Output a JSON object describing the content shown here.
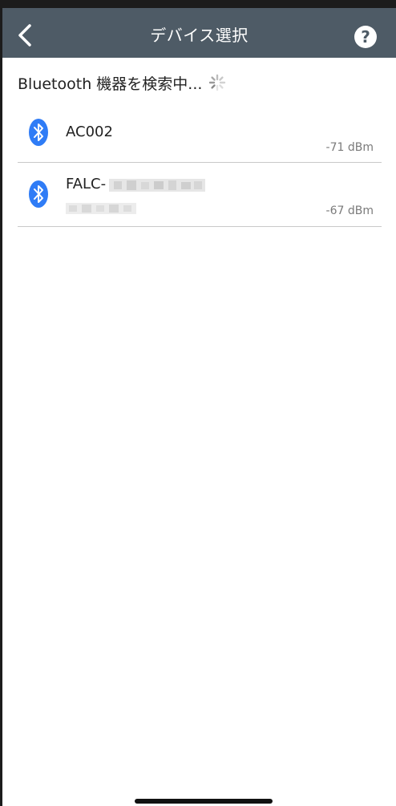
{
  "header": {
    "title": "デバイス選択",
    "help_label": "?"
  },
  "scan": {
    "label": "Bluetooth 機器を検索中..."
  },
  "devices": [
    {
      "name": "AC002",
      "rssi": "-71 dBm"
    },
    {
      "name": "FALC-",
      "rssi": "-67 dBm"
    }
  ],
  "colors": {
    "navbar": "#4e5b66",
    "bluetooth": "#2f7cf6"
  },
  "icons": {
    "back": "chevron-left-icon",
    "help": "question-icon",
    "bluetooth": "bluetooth-icon",
    "spinner": "spinner-icon"
  }
}
